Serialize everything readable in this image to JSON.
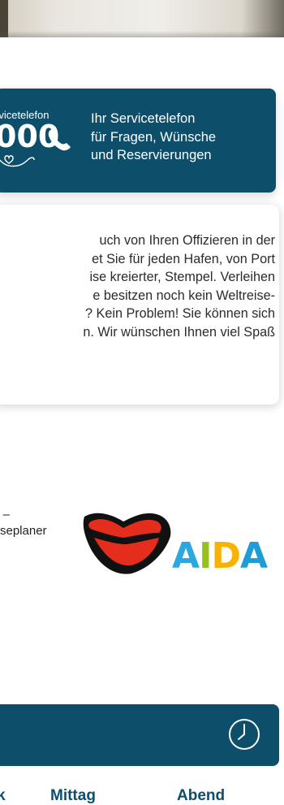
{
  "service": {
    "label": "rvicetelefon",
    "number": "000",
    "lines": [
      "Ihr Servicetelefon",
      "für Fragen, Wünsche",
      "und Reservierungen"
    ]
  },
  "info_card": {
    "lines": [
      "uch von Ihren Offizieren in der",
      "et Sie für jeden Hafen, von Port",
      "ise kreierter, Stempel. Verleihen",
      "e besitzen noch kein Weltreise-",
      "? Kein Problem! Sie können sich",
      "n. Wir wünschen Ihnen viel Spaß"
    ]
  },
  "planer": {
    "lines": [
      "l –",
      "seplaner"
    ]
  },
  "logo": {
    "word": [
      "A",
      "I",
      "D",
      "A"
    ]
  },
  "meals": {
    "k": "k",
    "mittag": "Mittag",
    "abend": "Abend"
  },
  "colors": {
    "brand_dark": "#0d4e6b",
    "lips_red": "#e52d1e"
  },
  "icons": [
    "phone-icon",
    "heart-icon",
    "clock-icon"
  ]
}
